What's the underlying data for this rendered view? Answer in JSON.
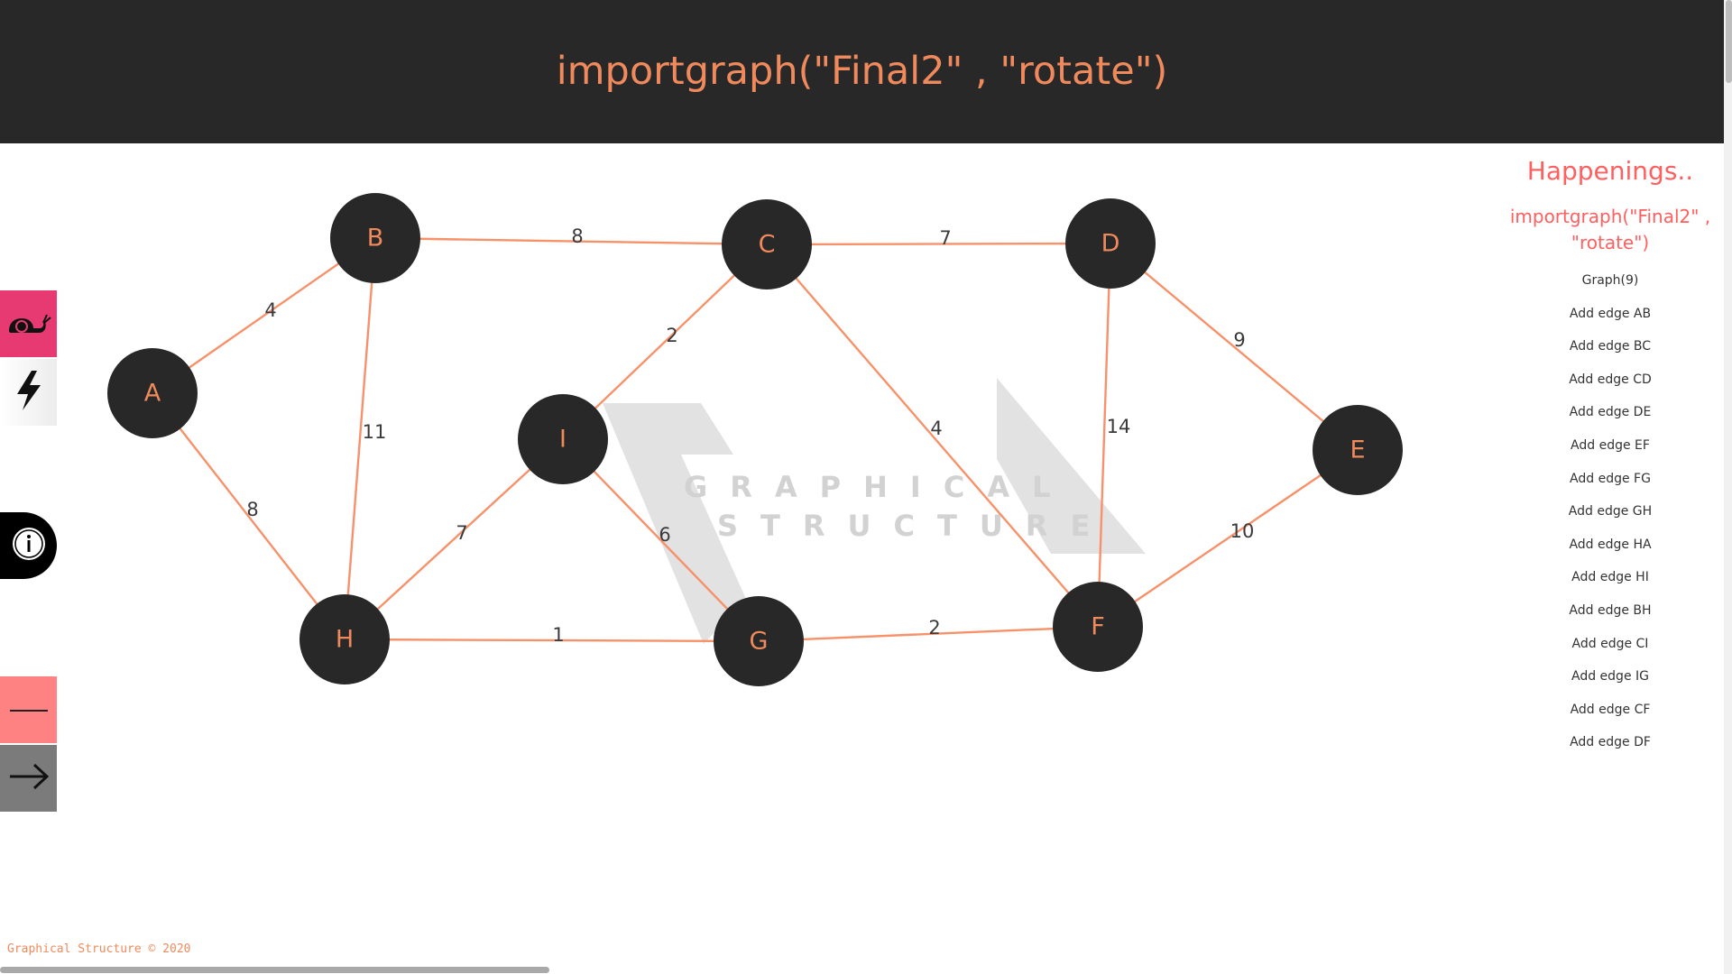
{
  "command": {
    "value": "importgraph(\"Final2\" , \"rotate\")"
  },
  "toolbar": {
    "snail_icon": "snail-icon",
    "lightning_icon": "lightning-icon",
    "info_icon": "info-icon",
    "line_icon": "line-icon",
    "arrow_icon": "arrow-right-icon"
  },
  "watermark": {
    "line1": "GRAPHICAL",
    "line2": "STRUCTURE"
  },
  "graph": {
    "nodes": [
      {
        "id": "A",
        "label": "A"
      },
      {
        "id": "B",
        "label": "B"
      },
      {
        "id": "C",
        "label": "C"
      },
      {
        "id": "D",
        "label": "D"
      },
      {
        "id": "E",
        "label": "E"
      },
      {
        "id": "F",
        "label": "F"
      },
      {
        "id": "G",
        "label": "G"
      },
      {
        "id": "H",
        "label": "H"
      },
      {
        "id": "I",
        "label": "I"
      }
    ],
    "edges": [
      {
        "from": "A",
        "to": "B",
        "weight": "4"
      },
      {
        "from": "B",
        "to": "C",
        "weight": "8"
      },
      {
        "from": "C",
        "to": "D",
        "weight": "7"
      },
      {
        "from": "D",
        "to": "E",
        "weight": "9"
      },
      {
        "from": "E",
        "to": "F",
        "weight": "10"
      },
      {
        "from": "F",
        "to": "G",
        "weight": "2"
      },
      {
        "from": "G",
        "to": "H",
        "weight": "1"
      },
      {
        "from": "H",
        "to": "A",
        "weight": "8"
      },
      {
        "from": "H",
        "to": "I",
        "weight": "7"
      },
      {
        "from": "B",
        "to": "H",
        "weight": "11"
      },
      {
        "from": "C",
        "to": "I",
        "weight": "2"
      },
      {
        "from": "I",
        "to": "G",
        "weight": "6"
      },
      {
        "from": "C",
        "to": "F",
        "weight": "4"
      },
      {
        "from": "D",
        "to": "F",
        "weight": "14"
      }
    ]
  },
  "happenings": {
    "title": "Happenings..",
    "command": "importgraph(\"Final2\" , \"rotate\")",
    "items": [
      "Graph(9)",
      "Add edge AB",
      "Add edge BC",
      "Add edge CD",
      "Add edge DE",
      "Add edge EF",
      "Add edge FG",
      "Add edge GH",
      "Add edge HA",
      "Add edge HI",
      "Add edge BH",
      "Add edge CI",
      "Add edge IG",
      "Add edge CF",
      "Add edge DF"
    ]
  },
  "footer": {
    "text": "Graphical Structure © 2020"
  },
  "colors": {
    "accent": "#f08a5d",
    "header_bg": "#282828",
    "node_fill": "#282828",
    "edge": "#f7916a",
    "happenings": "#ff5f5f",
    "snail_btn": "#e83a72",
    "line_btn": "#ff8282",
    "arrow_btn": "#7b7b7b"
  }
}
